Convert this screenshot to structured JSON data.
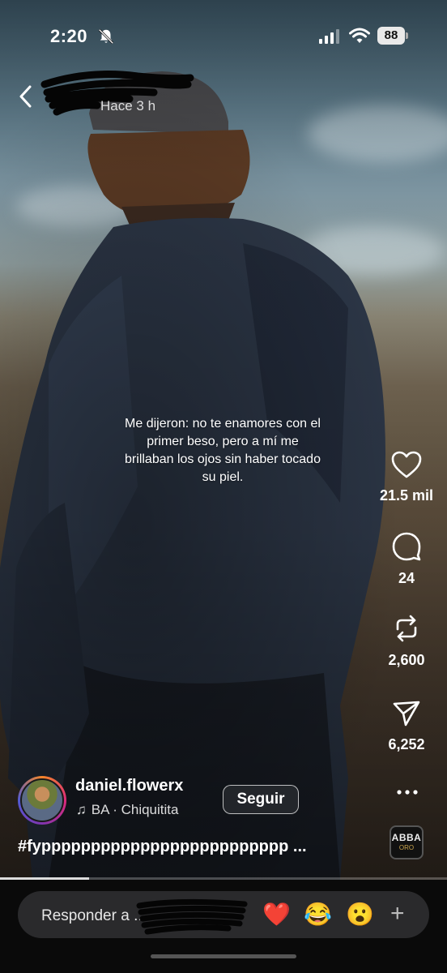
{
  "status_bar": {
    "time": "2:20",
    "battery": "88",
    "icons": [
      "bell-slash-icon",
      "signal-icon",
      "wifi-icon",
      "battery-icon"
    ]
  },
  "header": {
    "back_icon": "chevron-left-icon",
    "post_time": "Hace 3 h"
  },
  "overlay_caption": "Me dijeron: no te enamores con el primer beso, pero a mí me brillaban los ojos sin haber tocado su piel.",
  "actions": {
    "like": {
      "icon": "heart-icon",
      "count": "21.5 mil"
    },
    "comment": {
      "icon": "comment-icon",
      "count": "24"
    },
    "repost": {
      "icon": "repost-icon",
      "count": "2,600"
    },
    "share": {
      "icon": "send-icon",
      "count": "6,252"
    },
    "more_icon": "more-horizontal-icon"
  },
  "author": {
    "username": "daniel.flowerx",
    "music": "BA · Chiquitita",
    "follow_label": "Seguir"
  },
  "caption": {
    "hashtags": "#fyppppppppppppppppppppppppp ..."
  },
  "album": {
    "title": "ABBA",
    "subtitle": "ORO"
  },
  "progress": 0.2,
  "reply_bar": {
    "placeholder": "Responder a ...",
    "emojis": [
      "❤️",
      "😂",
      "😮"
    ],
    "add_label": "+"
  },
  "colors": {
    "bottom_bar": "#0a0a0a",
    "reply_box": "#2a2a2c",
    "text": "#ffffff"
  }
}
